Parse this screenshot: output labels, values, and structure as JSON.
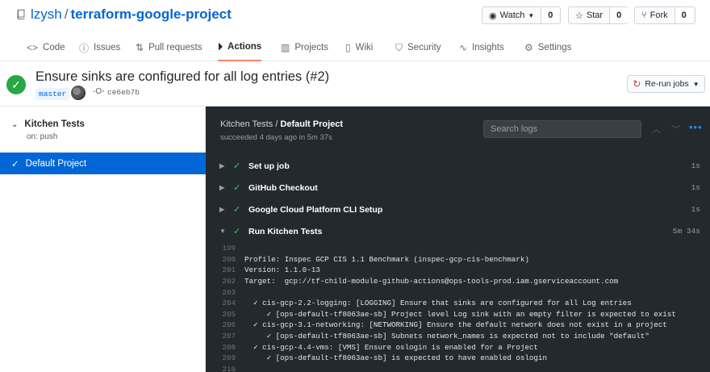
{
  "repo": {
    "owner": "lzysh",
    "separator": "/",
    "name": "terraform-google-project",
    "icon": "repo-icon"
  },
  "social": {
    "watch": {
      "label": "Watch",
      "count": "0",
      "icon": "eye-icon"
    },
    "star": {
      "label": "Star",
      "count": "0",
      "icon": "star-icon"
    },
    "fork": {
      "label": "Fork",
      "count": "0",
      "icon": "fork-icon"
    }
  },
  "tabs": [
    {
      "label": "Code",
      "icon": "code-icon"
    },
    {
      "label": "Issues",
      "icon": "issue-icon"
    },
    {
      "label": "Pull requests",
      "icon": "pull-request-icon"
    },
    {
      "label": "Actions",
      "icon": "play-icon",
      "active": true
    },
    {
      "label": "Projects",
      "icon": "project-icon"
    },
    {
      "label": "Wiki",
      "icon": "book-icon"
    },
    {
      "label": "Security",
      "icon": "shield-icon"
    },
    {
      "label": "Insights",
      "icon": "graph-icon"
    },
    {
      "label": "Settings",
      "icon": "gear-icon"
    }
  ],
  "run": {
    "title": "Ensure sinks are configured for all log entries (#2)",
    "branch": "master",
    "commit": "ce6eb7b",
    "status": "success",
    "rerun_label": "Re-run jobs"
  },
  "sidebar": {
    "workflow_name": "Kitchen Tests",
    "workflow_trigger": "on: push",
    "jobs": [
      {
        "label": "Default Project",
        "selected": true
      }
    ]
  },
  "log_panel": {
    "breadcrumb_workflow": "Kitchen Tests",
    "breadcrumb_sep": " / ",
    "job_name": "Default Project",
    "subtitle": "succeeded 4 days ago in 5m 37s",
    "search_placeholder": "Search logs",
    "steps": [
      {
        "label": "Set up job",
        "duration": "1s",
        "expanded": false
      },
      {
        "label": "GitHub Checkout",
        "duration": "1s",
        "expanded": false
      },
      {
        "label": "Google Cloud Platform CLI Setup",
        "duration": "1s",
        "expanded": false
      },
      {
        "label": "Run Kitchen Tests",
        "duration": "5m 34s",
        "expanded": true
      }
    ],
    "log_lines": [
      {
        "n": "199",
        "text": ""
      },
      {
        "n": "200",
        "text": "Profile: Inspec GCP CIS 1.1 Benchmark (inspec-gcp-cis-benchmark)"
      },
      {
        "n": "201",
        "text": "Version: 1.1.0-13"
      },
      {
        "n": "202",
        "text": "Target:  gcp://tf-child-module-github-actions@ops-tools-prod.iam.gserviceaccount.com"
      },
      {
        "n": "203",
        "text": ""
      },
      {
        "n": "204",
        "indent": "  ",
        "check": "✓",
        "text": " cis-gcp-2.2-logging: [LOGGING] Ensure that sinks are configured for all Log entries"
      },
      {
        "n": "205",
        "indent": "     ",
        "check": "✓",
        "text": " [ops-default-tf8063ae-sb] Project level Log sink with an empty filter is expected to exist"
      },
      {
        "n": "206",
        "indent": "  ",
        "check": "✓",
        "text": " cis-gcp-3.1-networking: [NETWORKING] Ensure the default network does not exist in a project"
      },
      {
        "n": "207",
        "indent": "     ",
        "check": "✓",
        "text": " [ops-default-tf8063ae-sb] Subnets network_names is expected not to include \"default\""
      },
      {
        "n": "208",
        "indent": "  ",
        "check": "✓",
        "text": " cis-gcp-4.4-vms: [VMS] Ensure oslogin is enabled for a Project"
      },
      {
        "n": "209",
        "indent": "     ",
        "check": "✓",
        "text": " [ops-default-tf8063ae-sb] is expected to have enabled oslogin"
      },
      {
        "n": "210",
        "text": ""
      }
    ]
  },
  "colors": {
    "accent": "#0366d6",
    "success": "#28a745",
    "log_bg": "#24292e",
    "active_tab_underline": "#f9826c",
    "rerun_icon": "#d73a49"
  }
}
